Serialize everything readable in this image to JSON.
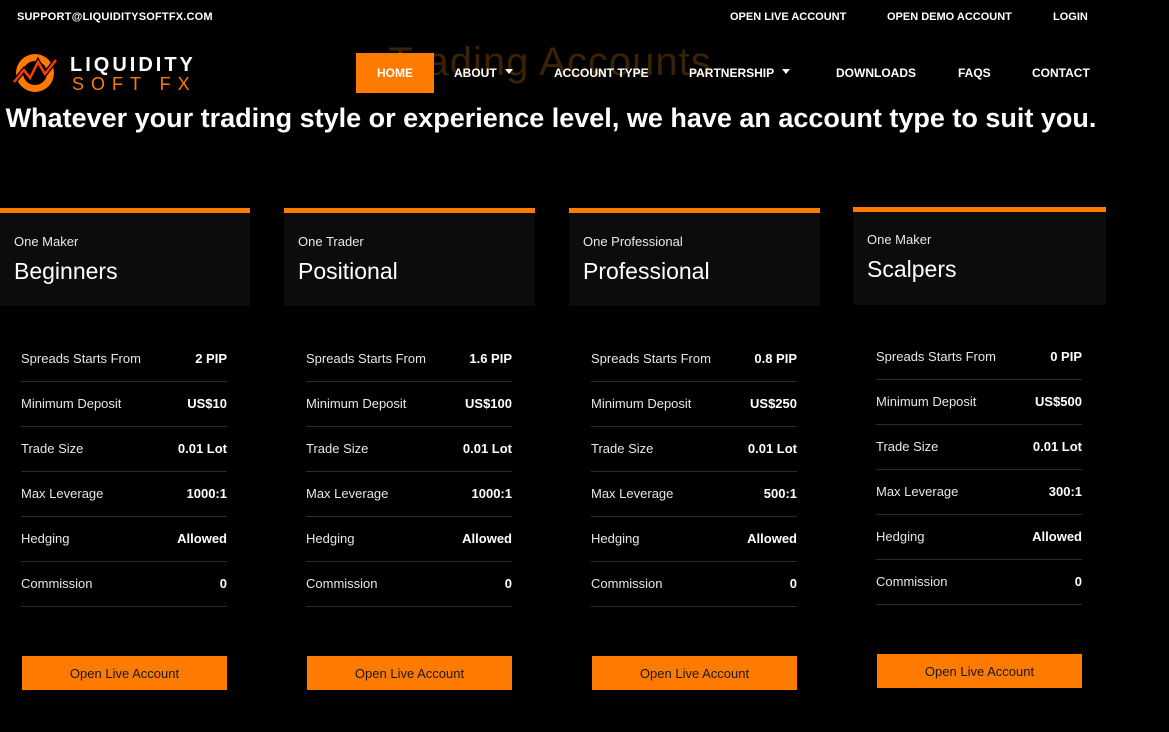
{
  "topbar": {
    "support_email": "SUPPORT@LIQUIDITYSOFTFX.COM",
    "open_live": "OPEN LIVE ACCOUNT",
    "open_demo": "OPEN DEMO ACCOUNT",
    "login": "LOGIN"
  },
  "logo": {
    "line1": "LIQUIDITY",
    "line2": "SOFT FX"
  },
  "nav": {
    "home": "HOME",
    "about": "ABOUT",
    "account_type": "ACCOUNT TYPE",
    "partnership": "PARTNERSHIP",
    "downloads": "DOWNLOADS",
    "faqs": "FAQS",
    "contact": "CONTACT"
  },
  "hero": {
    "title": "Trading Accounts",
    "subtitle": "Whatever your trading style or experience level, we have an account type to suit you."
  },
  "colors": {
    "accent": "#ff7a00",
    "background": "#000000",
    "card": "#0c0c0c"
  },
  "labels": {
    "spreads": "Spreads Starts From",
    "deposit": "Minimum Deposit",
    "trade_size": "Trade Size",
    "leverage": "Max Leverage",
    "hedging": "Hedging",
    "commission": "Commission",
    "button": "Open Live Account"
  },
  "accounts": [
    {
      "sub": "One Maker",
      "name": "Beginners",
      "spreads": "2 PIP",
      "deposit": "US$10",
      "trade_size": "0.01 Lot",
      "leverage": "1000:1",
      "hedging": "Allowed",
      "commission": "0"
    },
    {
      "sub": "One Trader",
      "name": "Positional",
      "spreads": "1.6 PIP",
      "deposit": "US$100",
      "trade_size": "0.01 Lot",
      "leverage": "1000:1",
      "hedging": "Allowed",
      "commission": "0"
    },
    {
      "sub": "One Professional",
      "name": "Professional",
      "spreads": "0.8 PIP",
      "deposit": "US$250",
      "trade_size": "0.01 Lot",
      "leverage": "500:1",
      "hedging": "Allowed",
      "commission": "0"
    },
    {
      "sub": "One Maker",
      "name": "Scalpers",
      "spreads": "0 PIP",
      "deposit": "US$500",
      "trade_size": "0.01 Lot",
      "leverage": "300:1",
      "hedging": "Allowed",
      "commission": "0"
    }
  ]
}
